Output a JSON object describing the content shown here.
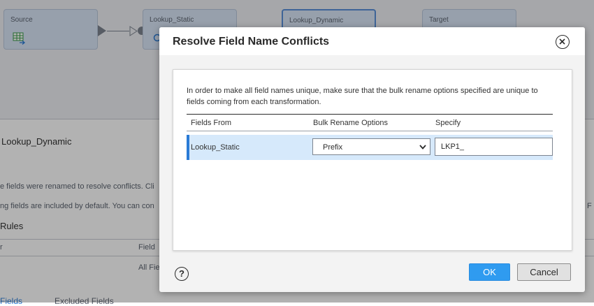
{
  "background": {
    "nodes": [
      {
        "label": "Source"
      },
      {
        "label": "Lookup_Static"
      },
      {
        "label": "Lookup_Dynamic"
      },
      {
        "label": "Target"
      }
    ],
    "panel_title": "Lookup_Dynamic",
    "info_line_1": "e fields were renamed to resolve conflicts. Cli",
    "info_line_2": "ng fields are included by default. You can con",
    "right_fragment": "F",
    "rules_heading": "Rules",
    "col_header_left": "r",
    "col_header_field": "Field",
    "row_value": "All Fie",
    "tab_fields": "Fields",
    "tab_excluded": "Excluded Fields"
  },
  "dialog": {
    "title": "Resolve Field Name Conflicts",
    "instructions": "In order to make all field names unique, make sure that the bulk rename options specified are unique to fields coming from each transformation.",
    "table": {
      "headers": [
        "Fields From",
        "Bulk Rename Options",
        "Specify"
      ],
      "rows": [
        {
          "fields_from": "Lookup_Static",
          "bulk_rename_option": "Prefix",
          "specify": "LKP1_"
        }
      ]
    },
    "help_label": "?",
    "ok_label": "OK",
    "cancel_label": "Cancel"
  },
  "colors": {
    "primary_button": "#2f9bf0",
    "row_highlight": "#d6e9fb",
    "row_accent": "#2a7bd6",
    "node_fill": "#d9e6f7"
  },
  "icons": [
    "close-icon",
    "help-icon",
    "chevron-down-icon",
    "table-icon",
    "lookup-icon"
  ]
}
